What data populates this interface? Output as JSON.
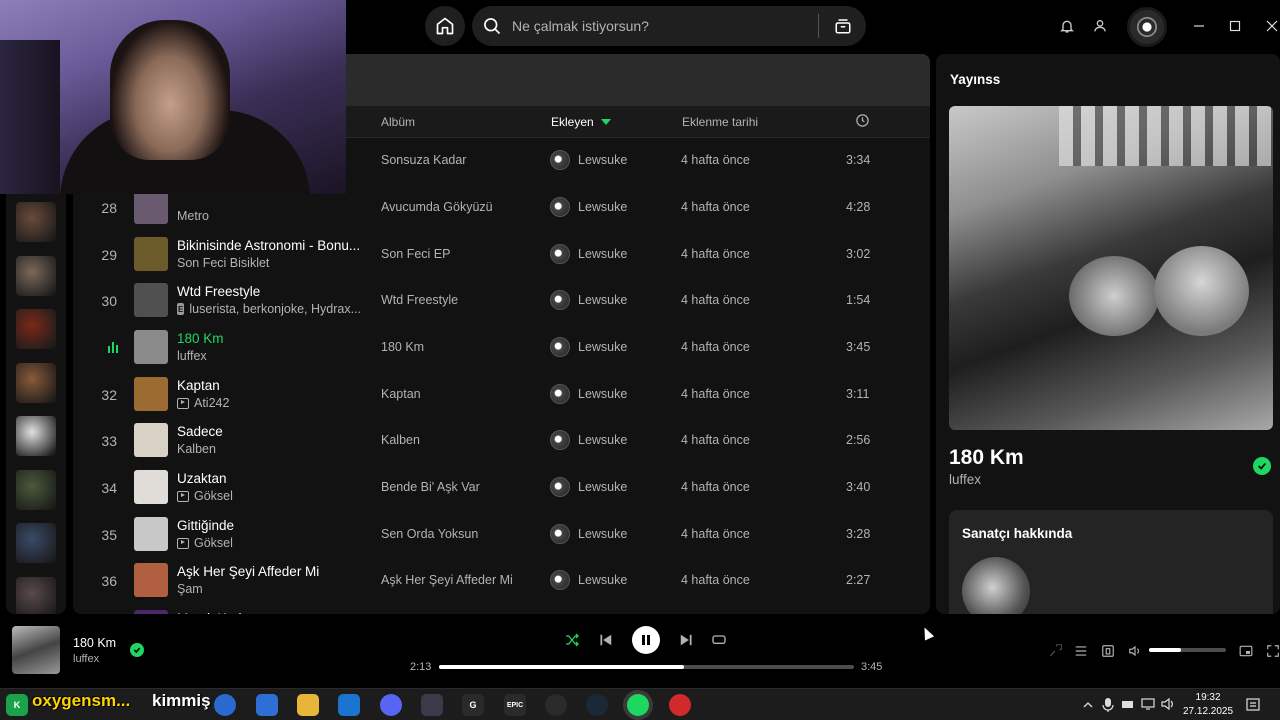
{
  "search": {
    "placeholder": "Ne çalmak istiyorsun?"
  },
  "columns": {
    "album": "Albüm",
    "added_by": "Ekleyen",
    "date_added": "Eklenme tarihi"
  },
  "tracks": [
    {
      "num": "",
      "title": "",
      "artist": "",
      "album": "Sonsuza Kadar",
      "added_by": "Lewsuke",
      "added": "4 hafta önce",
      "duration": "3:34",
      "thumb": "#3a3a3a"
    },
    {
      "num": "28",
      "title": "",
      "artist": "Metro",
      "album": "Avucumda Gökyüzü",
      "added_by": "Lewsuke",
      "added": "4 hafta önce",
      "duration": "4:28",
      "thumb": "#6a5a70"
    },
    {
      "num": "29",
      "title": "Bikinisinde Astronomi - Bonu...",
      "artist": "Son Feci Bisiklet",
      "album": "Son Feci EP",
      "added_by": "Lewsuke",
      "added": "4 hafta önce",
      "duration": "3:02",
      "thumb": "#6b5a2a"
    },
    {
      "num": "30",
      "title": "Wtd Freestyle",
      "artist": "luserista, berkonjoke, Hydrax...",
      "explicit": true,
      "album": "Wtd Freestyle",
      "added_by": "Lewsuke",
      "added": "4 hafta önce",
      "duration": "1:54",
      "thumb": "#505050"
    },
    {
      "num": "",
      "title": "180 Km",
      "artist": "luffex",
      "album": "180 Km",
      "added_by": "Lewsuke",
      "added": "4 hafta önce",
      "duration": "3:45",
      "thumb": "#8a8a8a",
      "playing": true
    },
    {
      "num": "32",
      "title": "Kaptan",
      "artist": "Ati242",
      "video": true,
      "album": "Kaptan",
      "added_by": "Lewsuke",
      "added": "4 hafta önce",
      "duration": "3:11",
      "thumb": "#9a6a30"
    },
    {
      "num": "33",
      "title": "Sadece",
      "artist": "Kalben",
      "album": "Kalben",
      "added_by": "Lewsuke",
      "added": "4 hafta önce",
      "duration": "2:56",
      "thumb": "#d8d2c4"
    },
    {
      "num": "34",
      "title": "Uzaktan",
      "artist": "Göksel",
      "video": true,
      "album": "Bende Bi' Aşk Var",
      "added_by": "Lewsuke",
      "added": "4 hafta önce",
      "duration": "3:40",
      "thumb": "#e0dcd8"
    },
    {
      "num": "35",
      "title": "Gittiğinde",
      "artist": "Göksel",
      "video": true,
      "album": "Sen Orda Yoksun",
      "added_by": "Lewsuke",
      "added": "4 hafta önce",
      "duration": "3:28",
      "thumb": "#c8c8c8"
    },
    {
      "num": "36",
      "title": "Aşk Her Şeyi Affeder Mi",
      "artist": "Şam",
      "album": "Aşk Her Şeyi Affeder Mi",
      "added_by": "Lewsuke",
      "added": "4 hafta önce",
      "duration": "2:27",
      "thumb": "#b06040"
    },
    {
      "num": "",
      "title": "Marslı Kadın",
      "artist": "",
      "album": "",
      "added_by": "",
      "added": "",
      "duration": "",
      "thumb": "#4a2a6a"
    }
  ],
  "right_panel": {
    "title": "Yayınss",
    "song": "180 Km",
    "artist": "luffex",
    "about_title": "Sanatçı hakkında"
  },
  "player": {
    "title": "180 Km",
    "artist": "luffex",
    "elapsed": "2:13",
    "total": "3:45",
    "progress": 0.59,
    "volume": 0.42
  },
  "taskbar": {
    "overlay_yellow": "oxygensm...",
    "overlay_white": "kimmiş",
    "time": "19:32",
    "date": "27.12.2025",
    "epic_label": "EPIC"
  },
  "colors": {
    "accent": "#1ed760",
    "bg": "#121212"
  },
  "library_thumbs": [
    "#6b4a3a",
    "#7a6a5a",
    "#7a2a1a",
    "#8a5a3a",
    "#e0e0e0",
    "#4a5a3a",
    "#3a4a6a",
    "#5a4a4a"
  ]
}
